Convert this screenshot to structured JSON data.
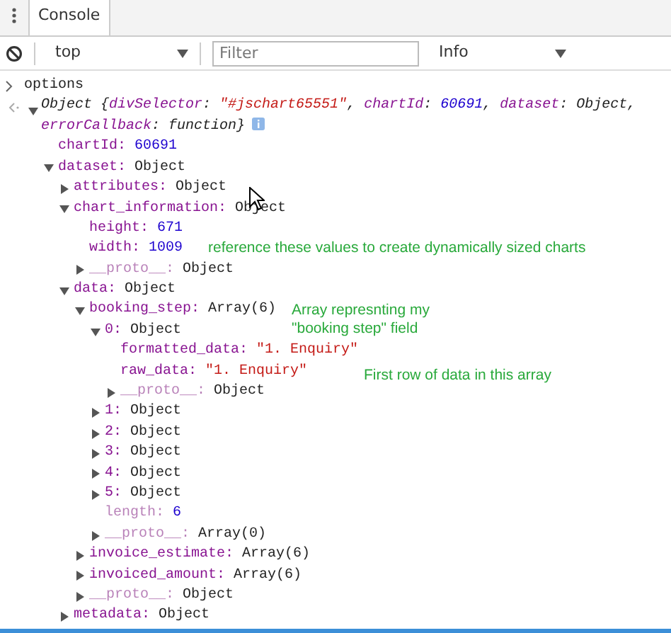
{
  "tabs": [
    {
      "label": "Console",
      "selected": true
    }
  ],
  "toolbar": {
    "context": "top",
    "filter": {
      "placeholder": "Filter"
    },
    "level": "Info"
  },
  "input": {
    "command": "options"
  },
  "result": {
    "expanded": true,
    "summary": [
      {
        "text": "Object {",
        "kind": "plain"
      },
      {
        "text": "divSelector",
        "kind": "key"
      },
      {
        "text": ": ",
        "kind": "plain"
      },
      {
        "text": "\"#jschart65551\"",
        "kind": "string"
      },
      {
        "text": ", ",
        "kind": "plain"
      },
      {
        "text": "chartId",
        "kind": "key"
      },
      {
        "text": ": ",
        "kind": "plain"
      },
      {
        "text": "60691",
        "kind": "number"
      },
      {
        "text": ", ",
        "kind": "plain"
      },
      {
        "text": "dataset",
        "kind": "key"
      },
      {
        "text": ": Object, ",
        "kind": "plain"
      },
      {
        "text": "errorCallback",
        "kind": "key"
      },
      {
        "text": ": function}",
        "kind": "plain"
      }
    ],
    "children": [
      {
        "key": "chartId:",
        "value": "60691",
        "kind": "number",
        "internal": false
      },
      {
        "key": "dataset:",
        "value": "Object",
        "kind": "object",
        "internal": false,
        "expanded": true,
        "children": [
          {
            "key": "attributes:",
            "value": "Object",
            "kind": "object",
            "internal": false,
            "expanded": false
          },
          {
            "key": "chart_information:",
            "value": "Object",
            "kind": "object",
            "internal": false,
            "expanded": true,
            "children": [
              {
                "key": "height:",
                "value": "671",
                "kind": "number",
                "internal": false
              },
              {
                "key": "width:",
                "value": "1009",
                "kind": "number",
                "internal": false
              },
              {
                "key": "__proto__:",
                "value": "Object",
                "kind": "object",
                "internal": true,
                "expanded": false
              }
            ]
          },
          {
            "key": "data:",
            "value": "Object",
            "kind": "object",
            "internal": false,
            "expanded": true,
            "children": [
              {
                "key": "booking_step:",
                "value": "Array(6)",
                "kind": "object",
                "internal": false,
                "expanded": true,
                "children": [
                  {
                    "key": "0:",
                    "value": "Object",
                    "kind": "object",
                    "internal": false,
                    "expanded": true,
                    "children": [
                      {
                        "key": "formatted_data:",
                        "value": "\"1. Enquiry\"",
                        "kind": "string",
                        "internal": false
                      },
                      {
                        "key": "raw_data:",
                        "value": "\"1. Enquiry\"",
                        "kind": "string",
                        "internal": false
                      },
                      {
                        "key": "__proto__:",
                        "value": "Object",
                        "kind": "object",
                        "internal": true,
                        "expanded": false
                      }
                    ]
                  },
                  {
                    "key": "1:",
                    "value": "Object",
                    "kind": "object",
                    "internal": false,
                    "expanded": false
                  },
                  {
                    "key": "2:",
                    "value": "Object",
                    "kind": "object",
                    "internal": false,
                    "expanded": false
                  },
                  {
                    "key": "3:",
                    "value": "Object",
                    "kind": "object",
                    "internal": false,
                    "expanded": false
                  },
                  {
                    "key": "4:",
                    "value": "Object",
                    "kind": "object",
                    "internal": false,
                    "expanded": false
                  },
                  {
                    "key": "5:",
                    "value": "Object",
                    "kind": "object",
                    "internal": false,
                    "expanded": false
                  },
                  {
                    "key": "length:",
                    "value": "6",
                    "kind": "number",
                    "internal": true
                  },
                  {
                    "key": "__proto__:",
                    "value": "Array(0)",
                    "kind": "object",
                    "internal": true,
                    "expanded": false
                  }
                ]
              },
              {
                "key": "invoice_estimate:",
                "value": "Array(6)",
                "kind": "object",
                "internal": false,
                "expanded": false
              },
              {
                "key": "invoiced_amount:",
                "value": "Array(6)",
                "kind": "object",
                "internal": false,
                "expanded": false
              },
              {
                "key": "__proto__:",
                "value": "Object",
                "kind": "object",
                "internal": true,
                "expanded": false
              }
            ]
          },
          {
            "key": "metadata:",
            "value": "Object",
            "kind": "object",
            "internal": false,
            "expanded": false
          }
        ]
      }
    ]
  },
  "notes": [
    "reference these values to create dynamically sized charts",
    "Array represnting my \"booking step\" field",
    "First row of data in this array"
  ]
}
